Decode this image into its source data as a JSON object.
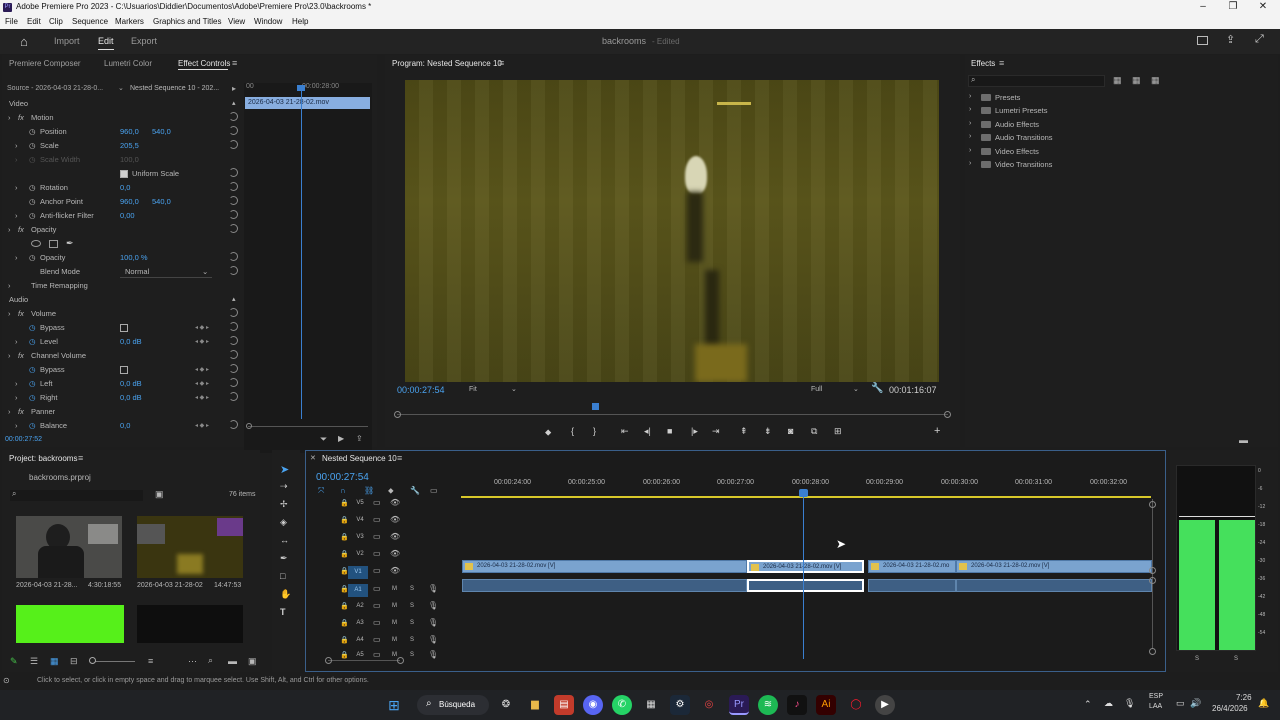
{
  "window": {
    "title": "Adobe Premiere Pro 2023 - C:\\Usuarios\\Diddier\\Documentos\\Adobe\\Premiere Pro\\23.0\\backrooms *"
  },
  "menu": [
    "File",
    "Edit",
    "Clip",
    "Sequence",
    "Markers",
    "Graphics and Titles",
    "View",
    "Window",
    "Help"
  ],
  "appbar": {
    "tabs": [
      "Import",
      "Edit",
      "Export"
    ],
    "project_name": "backrooms",
    "status": "- Edited"
  },
  "effect_controls": {
    "tabs": [
      "Premiere Composer",
      "Lumetri Color",
      "Effect Controls"
    ],
    "source_label": "Source - 2026-04-03 21-28-0...",
    "sequence_label": "Nested Sequence 10 - 202...",
    "ruler_labels": [
      "00",
      "00:00:28:00"
    ],
    "clip_label": "2026-04-03 21-28-02.mov",
    "sections": {
      "video": "Video",
      "audio": "Audio"
    },
    "rows": {
      "motion": "Motion",
      "position": {
        "label": "Position",
        "x": "960,0",
        "y": "540,0"
      },
      "scale": {
        "label": "Scale",
        "value": "205,5"
      },
      "scale_width": {
        "label": "Scale Width",
        "value": "100,0"
      },
      "uniform_scale": "Uniform Scale",
      "rotation": {
        "label": "Rotation",
        "value": "0,0"
      },
      "anchor": {
        "label": "Anchor Point",
        "x": "960,0",
        "y": "540,0"
      },
      "antiflicker": {
        "label": "Anti-flicker Filter",
        "value": "0,00"
      },
      "opacity_fx": "Opacity",
      "opacity": {
        "label": "Opacity",
        "value": "100,0 %"
      },
      "blend": {
        "label": "Blend Mode",
        "value": "Normal"
      },
      "time_remap": "Time Remapping",
      "volume": "Volume",
      "bypass": "Bypass",
      "level": {
        "label": "Level",
        "value": "0,0 dB"
      },
      "channel_volume": "Channel Volume",
      "left": {
        "label": "Left",
        "value": "0,0 dB"
      },
      "right": {
        "label": "Right",
        "value": "0,0 dB"
      },
      "panner": "Panner",
      "balance": {
        "label": "Balance",
        "value": "0,0"
      }
    },
    "timecode": "00:00:27:52"
  },
  "program": {
    "tab": "Program: Nested Sequence 10",
    "timecode": "00:00:27:54",
    "fit": "Fit",
    "quality": "Full",
    "duration": "00:01:16:07"
  },
  "effects": {
    "tab": "Effects",
    "search_placeholder": "",
    "folders": [
      "Presets",
      "Lumetri Presets",
      "Audio Effects",
      "Audio Transitions",
      "Video Effects",
      "Video Transitions"
    ]
  },
  "project": {
    "tab": "Project: backrooms",
    "file": "backrooms.prproj",
    "items_count": "76 items",
    "thumbs": [
      {
        "name": "2026-04-03 21-28...",
        "duration": "4:30:18:55"
      },
      {
        "name": "2026-04-03 21-28-02",
        "duration": "14:47:53"
      }
    ]
  },
  "timeline": {
    "tab": "Nested Sequence 10",
    "timecode": "00:00:27:54",
    "ruler": [
      "00:00:24:00",
      "00:00:25:00",
      "00:00:26:00",
      "00:00:27:00",
      "00:00:28:00",
      "00:00:29:00",
      "00:00:30:00",
      "00:00:31:00",
      "00:00:32:00"
    ],
    "video_tracks": [
      "V5",
      "V4",
      "V3",
      "V2",
      "V1"
    ],
    "audio_tracks": [
      "A1",
      "A2",
      "A3",
      "A4",
      "A5"
    ],
    "clips": [
      "2026-04-03 21-28-02.mov [V]",
      "2026-04-03 21-28-02.mov [V]",
      "2026-04-03 21-28-02.mo",
      "2026-04-03 21-28-02.mov [V]"
    ]
  },
  "audio_meter": {
    "labels": [
      "0",
      "-6",
      "-12",
      "-18",
      "-24",
      "-30",
      "-36",
      "-42",
      "-48",
      "-54"
    ],
    "footer": [
      "S",
      "S"
    ]
  },
  "status_bar": "Click to select, or click in empty space and drag to marquee select. Use Shift, Alt, and Ctrl for other options.",
  "taskbar": {
    "search": "Búsqueda",
    "lang": "ESP",
    "region": "LAA",
    "time": "7:26",
    "date": "26/4/2026"
  }
}
